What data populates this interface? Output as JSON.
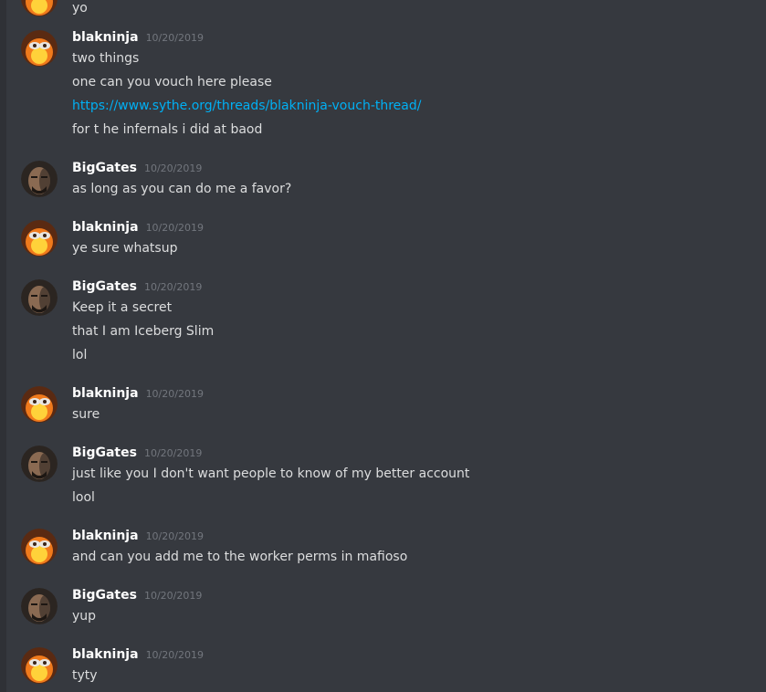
{
  "partial_message": {
    "text": "yo"
  },
  "messages": [
    {
      "author": "blakninja",
      "timestamp": "10/20/2019",
      "avatar": "fire-mask-avatar",
      "lines": [
        "two things",
        "one can you vouch here please",
        "https://www.sythe.org/threads/blakninja-vouch-thread/",
        "for t he infernals i did at baod"
      ]
    },
    {
      "author": "BigGates",
      "timestamp": "10/20/2019",
      "avatar": "face-avatar",
      "lines": [
        "as long as you can do me a favor?"
      ]
    },
    {
      "author": "blakninja",
      "timestamp": "10/20/2019",
      "avatar": "fire-mask-avatar",
      "lines": [
        "ye sure whatsup"
      ]
    },
    {
      "author": "BigGates",
      "timestamp": "10/20/2019",
      "avatar": "face-avatar",
      "lines": [
        "Keep it a secret",
        "that I am Iceberg Slim",
        "lol"
      ]
    },
    {
      "author": "blakninja",
      "timestamp": "10/20/2019",
      "avatar": "fire-mask-avatar",
      "lines": [
        "sure"
      ]
    },
    {
      "author": "BigGates",
      "timestamp": "10/20/2019",
      "avatar": "face-avatar",
      "lines": [
        "just like you I don't want people to know of my better account",
        "lool"
      ]
    },
    {
      "author": "blakninja",
      "timestamp": "10/20/2019",
      "avatar": "fire-mask-avatar",
      "lines": [
        "and can you add me to the worker perms in mafioso"
      ]
    },
    {
      "author": "BigGates",
      "timestamp": "10/20/2019",
      "avatar": "face-avatar",
      "lines": [
        "yup"
      ]
    },
    {
      "author": "blakninja",
      "timestamp": "10/20/2019",
      "avatar": "fire-mask-avatar",
      "lines": [
        "tyty"
      ]
    }
  ],
  "colors": {
    "background": "#36393f",
    "username": "#ffffff",
    "timestamp": "#72767d",
    "text": "#dcddde",
    "link": "#00b0f4"
  }
}
